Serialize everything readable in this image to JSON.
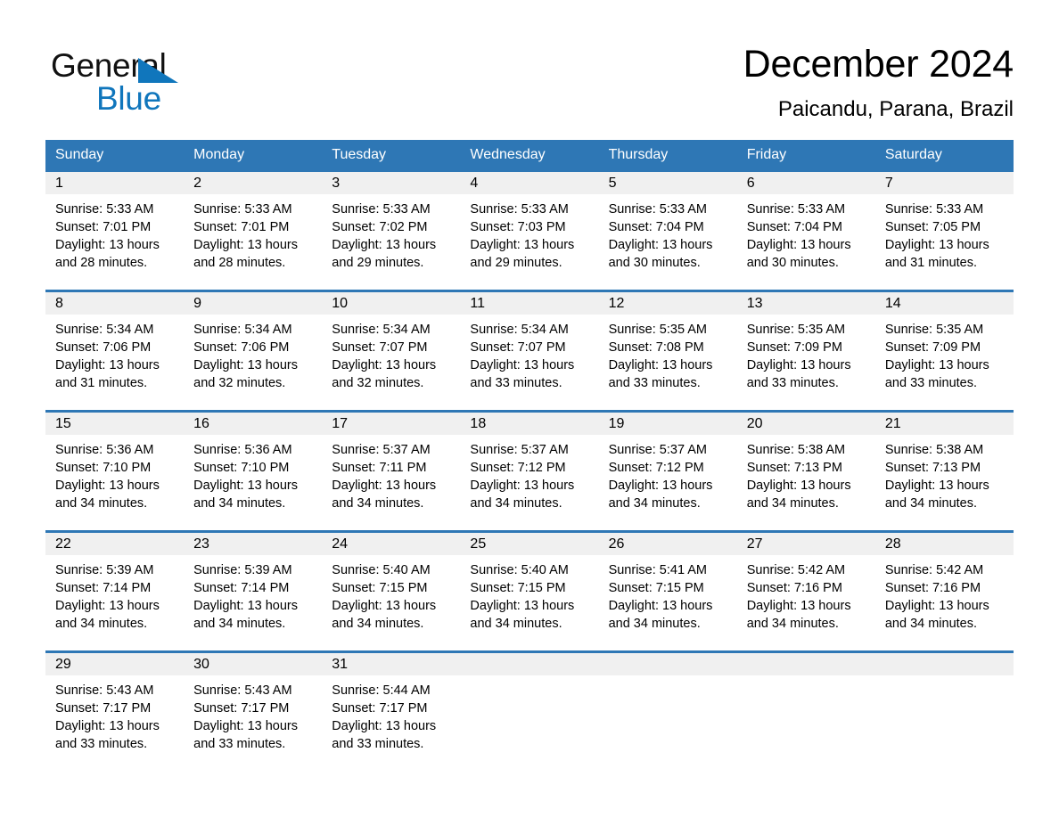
{
  "brand": {
    "name_part1": "General",
    "name_part2": "Blue",
    "accent_color": "#1076BC"
  },
  "header": {
    "title": "December 2024",
    "subtitle": "Paicandu, Parana, Brazil"
  },
  "theme": {
    "header_bar_color": "#2E77B5",
    "day_band_color": "#F0F0F0",
    "text_color": "#000000"
  },
  "weekdays": [
    "Sunday",
    "Monday",
    "Tuesday",
    "Wednesday",
    "Thursday",
    "Friday",
    "Saturday"
  ],
  "weeks": [
    [
      {
        "day": "1",
        "sunrise": "Sunrise: 5:33 AM",
        "sunset": "Sunset: 7:01 PM",
        "daylight_l1": "Daylight: 13 hours",
        "daylight_l2": "and 28 minutes."
      },
      {
        "day": "2",
        "sunrise": "Sunrise: 5:33 AM",
        "sunset": "Sunset: 7:01 PM",
        "daylight_l1": "Daylight: 13 hours",
        "daylight_l2": "and 28 minutes."
      },
      {
        "day": "3",
        "sunrise": "Sunrise: 5:33 AM",
        "sunset": "Sunset: 7:02 PM",
        "daylight_l1": "Daylight: 13 hours",
        "daylight_l2": "and 29 minutes."
      },
      {
        "day": "4",
        "sunrise": "Sunrise: 5:33 AM",
        "sunset": "Sunset: 7:03 PM",
        "daylight_l1": "Daylight: 13 hours",
        "daylight_l2": "and 29 minutes."
      },
      {
        "day": "5",
        "sunrise": "Sunrise: 5:33 AM",
        "sunset": "Sunset: 7:04 PM",
        "daylight_l1": "Daylight: 13 hours",
        "daylight_l2": "and 30 minutes."
      },
      {
        "day": "6",
        "sunrise": "Sunrise: 5:33 AM",
        "sunset": "Sunset: 7:04 PM",
        "daylight_l1": "Daylight: 13 hours",
        "daylight_l2": "and 30 minutes."
      },
      {
        "day": "7",
        "sunrise": "Sunrise: 5:33 AM",
        "sunset": "Sunset: 7:05 PM",
        "daylight_l1": "Daylight: 13 hours",
        "daylight_l2": "and 31 minutes."
      }
    ],
    [
      {
        "day": "8",
        "sunrise": "Sunrise: 5:34 AM",
        "sunset": "Sunset: 7:06 PM",
        "daylight_l1": "Daylight: 13 hours",
        "daylight_l2": "and 31 minutes."
      },
      {
        "day": "9",
        "sunrise": "Sunrise: 5:34 AM",
        "sunset": "Sunset: 7:06 PM",
        "daylight_l1": "Daylight: 13 hours",
        "daylight_l2": "and 32 minutes."
      },
      {
        "day": "10",
        "sunrise": "Sunrise: 5:34 AM",
        "sunset": "Sunset: 7:07 PM",
        "daylight_l1": "Daylight: 13 hours",
        "daylight_l2": "and 32 minutes."
      },
      {
        "day": "11",
        "sunrise": "Sunrise: 5:34 AM",
        "sunset": "Sunset: 7:07 PM",
        "daylight_l1": "Daylight: 13 hours",
        "daylight_l2": "and 33 minutes."
      },
      {
        "day": "12",
        "sunrise": "Sunrise: 5:35 AM",
        "sunset": "Sunset: 7:08 PM",
        "daylight_l1": "Daylight: 13 hours",
        "daylight_l2": "and 33 minutes."
      },
      {
        "day": "13",
        "sunrise": "Sunrise: 5:35 AM",
        "sunset": "Sunset: 7:09 PM",
        "daylight_l1": "Daylight: 13 hours",
        "daylight_l2": "and 33 minutes."
      },
      {
        "day": "14",
        "sunrise": "Sunrise: 5:35 AM",
        "sunset": "Sunset: 7:09 PM",
        "daylight_l1": "Daylight: 13 hours",
        "daylight_l2": "and 33 minutes."
      }
    ],
    [
      {
        "day": "15",
        "sunrise": "Sunrise: 5:36 AM",
        "sunset": "Sunset: 7:10 PM",
        "daylight_l1": "Daylight: 13 hours",
        "daylight_l2": "and 34 minutes."
      },
      {
        "day": "16",
        "sunrise": "Sunrise: 5:36 AM",
        "sunset": "Sunset: 7:10 PM",
        "daylight_l1": "Daylight: 13 hours",
        "daylight_l2": "and 34 minutes."
      },
      {
        "day": "17",
        "sunrise": "Sunrise: 5:37 AM",
        "sunset": "Sunset: 7:11 PM",
        "daylight_l1": "Daylight: 13 hours",
        "daylight_l2": "and 34 minutes."
      },
      {
        "day": "18",
        "sunrise": "Sunrise: 5:37 AM",
        "sunset": "Sunset: 7:12 PM",
        "daylight_l1": "Daylight: 13 hours",
        "daylight_l2": "and 34 minutes."
      },
      {
        "day": "19",
        "sunrise": "Sunrise: 5:37 AM",
        "sunset": "Sunset: 7:12 PM",
        "daylight_l1": "Daylight: 13 hours",
        "daylight_l2": "and 34 minutes."
      },
      {
        "day": "20",
        "sunrise": "Sunrise: 5:38 AM",
        "sunset": "Sunset: 7:13 PM",
        "daylight_l1": "Daylight: 13 hours",
        "daylight_l2": "and 34 minutes."
      },
      {
        "day": "21",
        "sunrise": "Sunrise: 5:38 AM",
        "sunset": "Sunset: 7:13 PM",
        "daylight_l1": "Daylight: 13 hours",
        "daylight_l2": "and 34 minutes."
      }
    ],
    [
      {
        "day": "22",
        "sunrise": "Sunrise: 5:39 AM",
        "sunset": "Sunset: 7:14 PM",
        "daylight_l1": "Daylight: 13 hours",
        "daylight_l2": "and 34 minutes."
      },
      {
        "day": "23",
        "sunrise": "Sunrise: 5:39 AM",
        "sunset": "Sunset: 7:14 PM",
        "daylight_l1": "Daylight: 13 hours",
        "daylight_l2": "and 34 minutes."
      },
      {
        "day": "24",
        "sunrise": "Sunrise: 5:40 AM",
        "sunset": "Sunset: 7:15 PM",
        "daylight_l1": "Daylight: 13 hours",
        "daylight_l2": "and 34 minutes."
      },
      {
        "day": "25",
        "sunrise": "Sunrise: 5:40 AM",
        "sunset": "Sunset: 7:15 PM",
        "daylight_l1": "Daylight: 13 hours",
        "daylight_l2": "and 34 minutes."
      },
      {
        "day": "26",
        "sunrise": "Sunrise: 5:41 AM",
        "sunset": "Sunset: 7:15 PM",
        "daylight_l1": "Daylight: 13 hours",
        "daylight_l2": "and 34 minutes."
      },
      {
        "day": "27",
        "sunrise": "Sunrise: 5:42 AM",
        "sunset": "Sunset: 7:16 PM",
        "daylight_l1": "Daylight: 13 hours",
        "daylight_l2": "and 34 minutes."
      },
      {
        "day": "28",
        "sunrise": "Sunrise: 5:42 AM",
        "sunset": "Sunset: 7:16 PM",
        "daylight_l1": "Daylight: 13 hours",
        "daylight_l2": "and 34 minutes."
      }
    ],
    [
      {
        "day": "29",
        "sunrise": "Sunrise: 5:43 AM",
        "sunset": "Sunset: 7:17 PM",
        "daylight_l1": "Daylight: 13 hours",
        "daylight_l2": "and 33 minutes."
      },
      {
        "day": "30",
        "sunrise": "Sunrise: 5:43 AM",
        "sunset": "Sunset: 7:17 PM",
        "daylight_l1": "Daylight: 13 hours",
        "daylight_l2": "and 33 minutes."
      },
      {
        "day": "31",
        "sunrise": "Sunrise: 5:44 AM",
        "sunset": "Sunset: 7:17 PM",
        "daylight_l1": "Daylight: 13 hours",
        "daylight_l2": "and 33 minutes."
      },
      {
        "day": "",
        "sunrise": "",
        "sunset": "",
        "daylight_l1": "",
        "daylight_l2": ""
      },
      {
        "day": "",
        "sunrise": "",
        "sunset": "",
        "daylight_l1": "",
        "daylight_l2": ""
      },
      {
        "day": "",
        "sunrise": "",
        "sunset": "",
        "daylight_l1": "",
        "daylight_l2": ""
      },
      {
        "day": "",
        "sunrise": "",
        "sunset": "",
        "daylight_l1": "",
        "daylight_l2": ""
      }
    ]
  ]
}
